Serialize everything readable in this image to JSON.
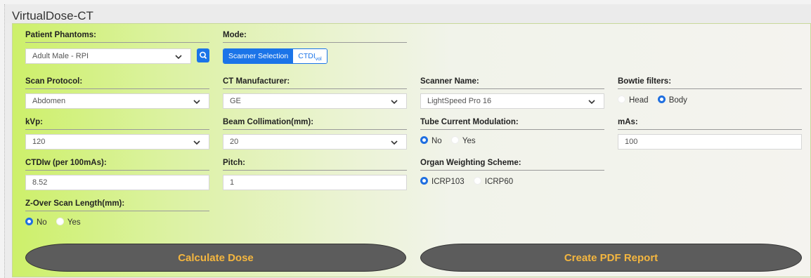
{
  "app": {
    "title": "VirtualDose-CT"
  },
  "colors": {
    "accent": "#1b74e8",
    "button_bg": "#5c5c5c",
    "button_text": "#f4b63f",
    "panel_left": "#cdf06a"
  },
  "patient_phantoms": {
    "label": "Patient Phantoms:",
    "value": "Adult Male - RPI",
    "search_icon": "search-icon"
  },
  "mode": {
    "label": "Mode:",
    "scanner_selection": "Scanner Selection",
    "ctdi_main": "CTDI",
    "ctdi_sub": "vol"
  },
  "scan_protocol": {
    "label": "Scan Protocol:",
    "value": "Abdomen"
  },
  "ct_manufacturer": {
    "label": "CT Manufacturer:",
    "value": "GE"
  },
  "scanner_name": {
    "label": "Scanner Name:",
    "value": "LightSpeed Pro 16"
  },
  "bowtie": {
    "label": "Bowtie filters:",
    "options": [
      "Head",
      "Body"
    ],
    "selected": "Body"
  },
  "kvp": {
    "label": "kVp:",
    "value": "120"
  },
  "beam_collimation": {
    "label": "Beam Collimation(mm):",
    "value": "20"
  },
  "tube_current": {
    "label": "Tube Current Modulation:",
    "options": [
      "No",
      "Yes"
    ],
    "selected": "No"
  },
  "mas": {
    "label": "mAs:",
    "value": "100"
  },
  "ctdiw": {
    "label": "CTDIw (per 100mAs):",
    "value": "8.52"
  },
  "pitch": {
    "label": "Pitch:",
    "value": "1"
  },
  "organ_weighting": {
    "label": "Organ Weighting Scheme:",
    "options": [
      "ICRP103",
      "ICRP60"
    ],
    "selected": "ICRP103"
  },
  "z_over": {
    "label": "Z-Over Scan Length(mm):",
    "options": [
      "No",
      "Yes"
    ],
    "selected": "No"
  },
  "actions": {
    "calculate": "Calculate Dose",
    "pdf": "Create PDF Report"
  }
}
